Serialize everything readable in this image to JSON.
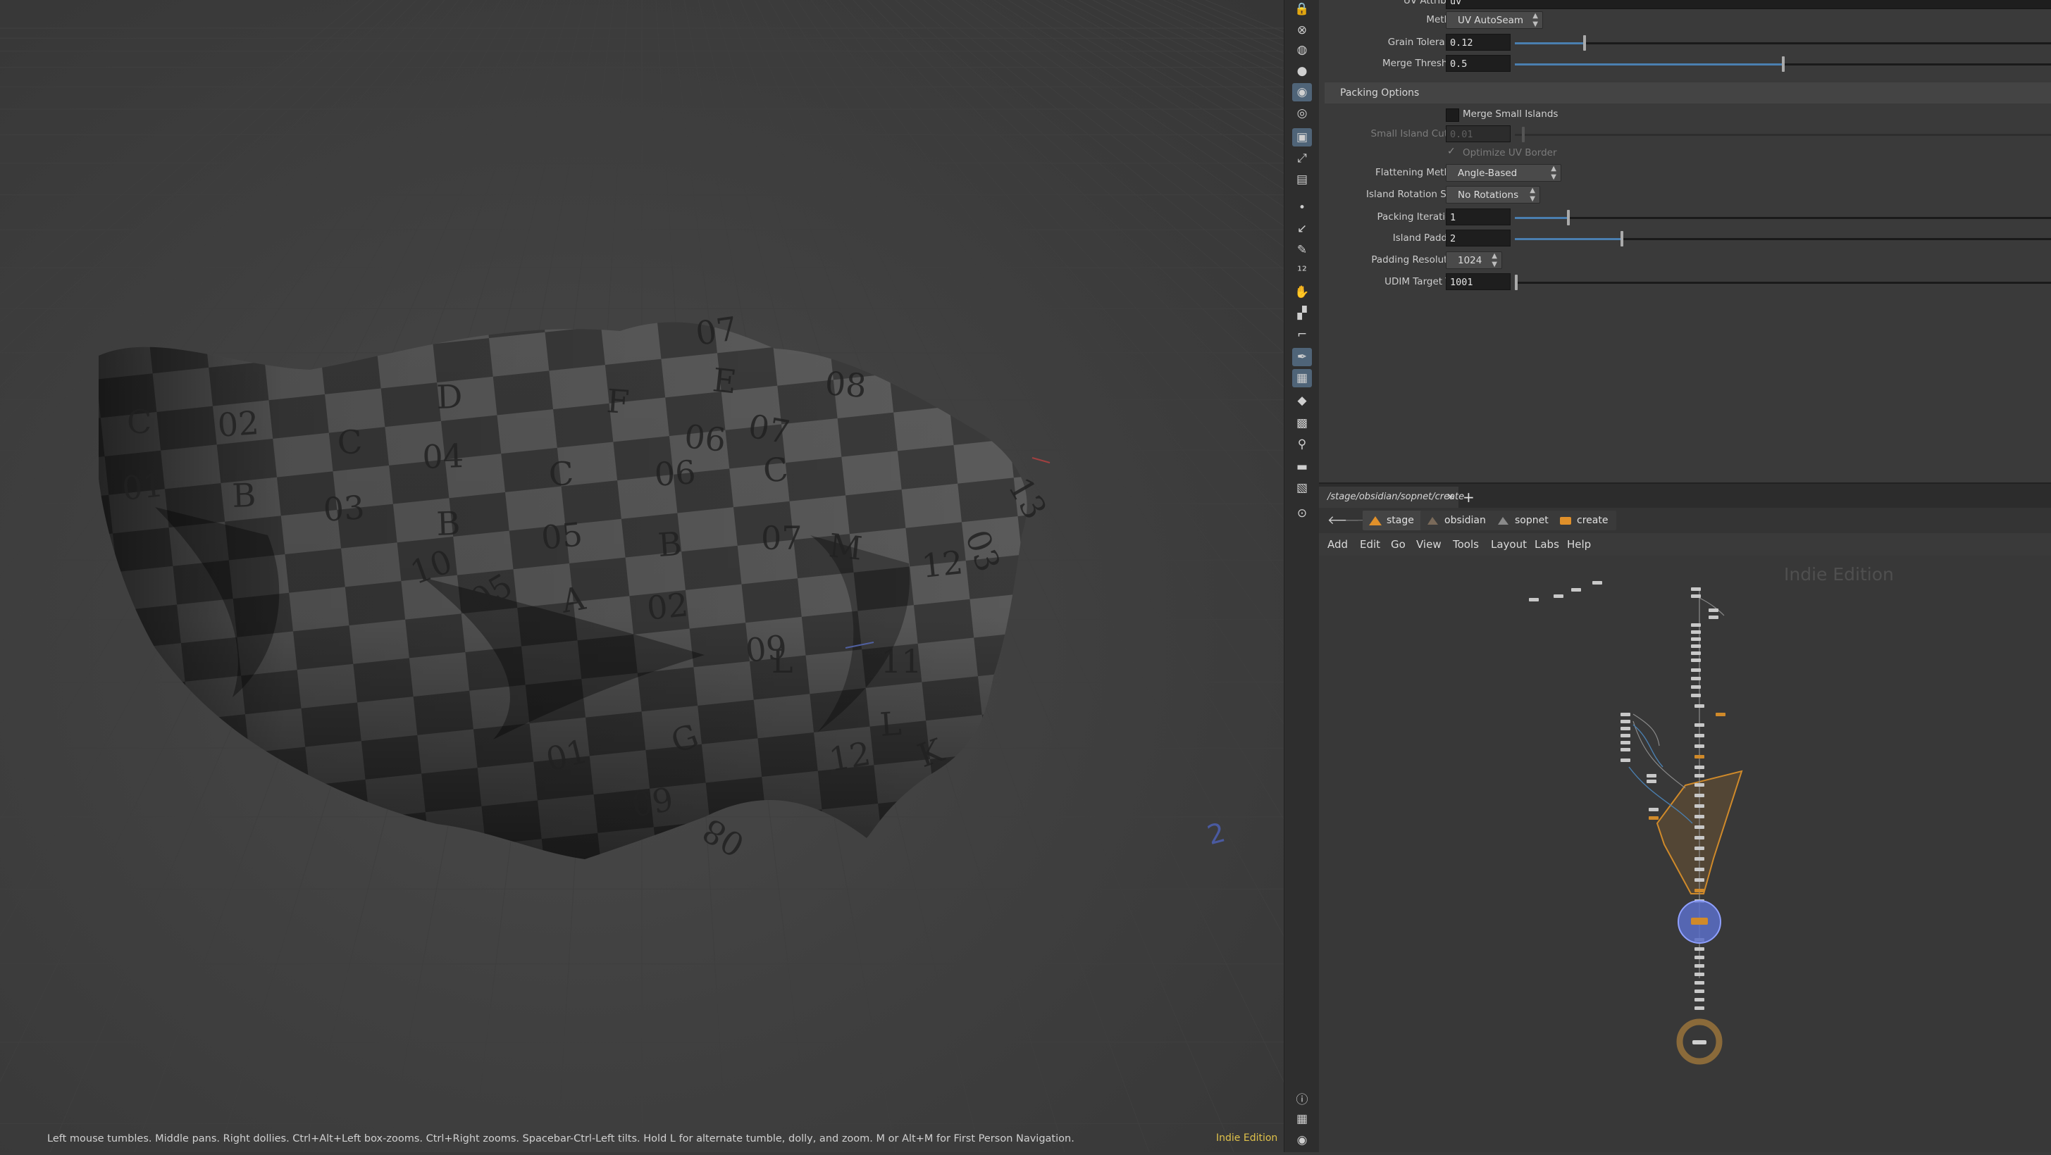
{
  "viewport": {
    "hint": "Left mouse tumbles. Middle pans. Right dollies. Ctrl+Alt+Left box-zooms. Ctrl+Right zooms. Spacebar-Ctrl-Left tilts. Hold L for alternate tumble, dolly, and zoom. M or Alt+M for First Person Navigation.",
    "edition": "Indie Edition",
    "cloth_labels": [
      "C",
      "02",
      "C",
      "04",
      "C",
      "06",
      "C",
      "08",
      "01",
      "B",
      "03",
      "B",
      "05",
      "B",
      "07",
      "M",
      "12",
      "D",
      "F",
      "E",
      "07",
      "A",
      "02",
      "L",
      "11",
      "L",
      "01",
      "G",
      "12",
      "K",
      "09",
      "13",
      "08",
      "07",
      "06",
      "05",
      "10",
      "09",
      "03"
    ]
  },
  "toolbar": {
    "icons": [
      "lock-icon",
      "snap-icon",
      "view-icon",
      "light-icon",
      "handle-icon",
      "pose-icon",
      "camera-icon",
      "select-icon",
      "group-icon",
      "dot-icon",
      "pick-icon",
      "brush-icon",
      "number-icon",
      "paint-icon",
      "bucket-icon",
      "measure-icon",
      "pen-icon",
      "grid-icon",
      "cube-icon",
      "image-icon",
      "axis-icon",
      "display-icon",
      "render-icon",
      "pin-icon",
      "info-icon",
      "layout-icon",
      "eye-icon"
    ]
  },
  "params": {
    "partial_top": "UV Attribute",
    "method": {
      "label": "Method",
      "value": "UV AutoSeam"
    },
    "grain_tolerance": {
      "label": "Grain Tolerance",
      "value": "0.12",
      "level": 0.13
    },
    "merge_threshold": {
      "label": "Merge Threshold",
      "value": "0.5",
      "level": 0.5
    },
    "packing_section": "Packing Options",
    "merge_small_islands": {
      "label": "Merge Small Islands",
      "checked": false
    },
    "small_island_cutoff": {
      "label": "Small Island CutOff",
      "value": "0.01"
    },
    "optimize_uv_border": {
      "label": "Optimize UV Border",
      "checked": true
    },
    "flattening_method": {
      "label": "Flattening Method",
      "value": "Angle-Based (ABF)"
    },
    "island_rotation_step": {
      "label": "Island Rotation Step",
      "value": "No Rotations"
    },
    "packing_iterations": {
      "label": "Packing Iterations",
      "value": "1",
      "level": 0.1
    },
    "island_padding": {
      "label": "Island Padding",
      "value": "2",
      "level": 0.2
    },
    "padding_resolution": {
      "label": "Padding Resolution",
      "value": "1024"
    },
    "udim_target_tile": {
      "label": "UDIM Target Tile",
      "value": "1001",
      "level": 0.0
    }
  },
  "network": {
    "tab_path": "/stage/obsidian/sopnet/create",
    "tab_close": "×",
    "tab_add": "+",
    "crumbs": [
      "stage",
      "obsidian",
      "sopnet",
      "create"
    ],
    "menus": [
      "Add",
      "Edit",
      "Go",
      "View",
      "Tools",
      "Layout",
      "Labs",
      "Help"
    ],
    "watermark": "Indie Edition"
  },
  "colors": {
    "accent": "#4a7fb0",
    "orange": "#d08a2a",
    "selected_node": "#5a6fc8"
  }
}
